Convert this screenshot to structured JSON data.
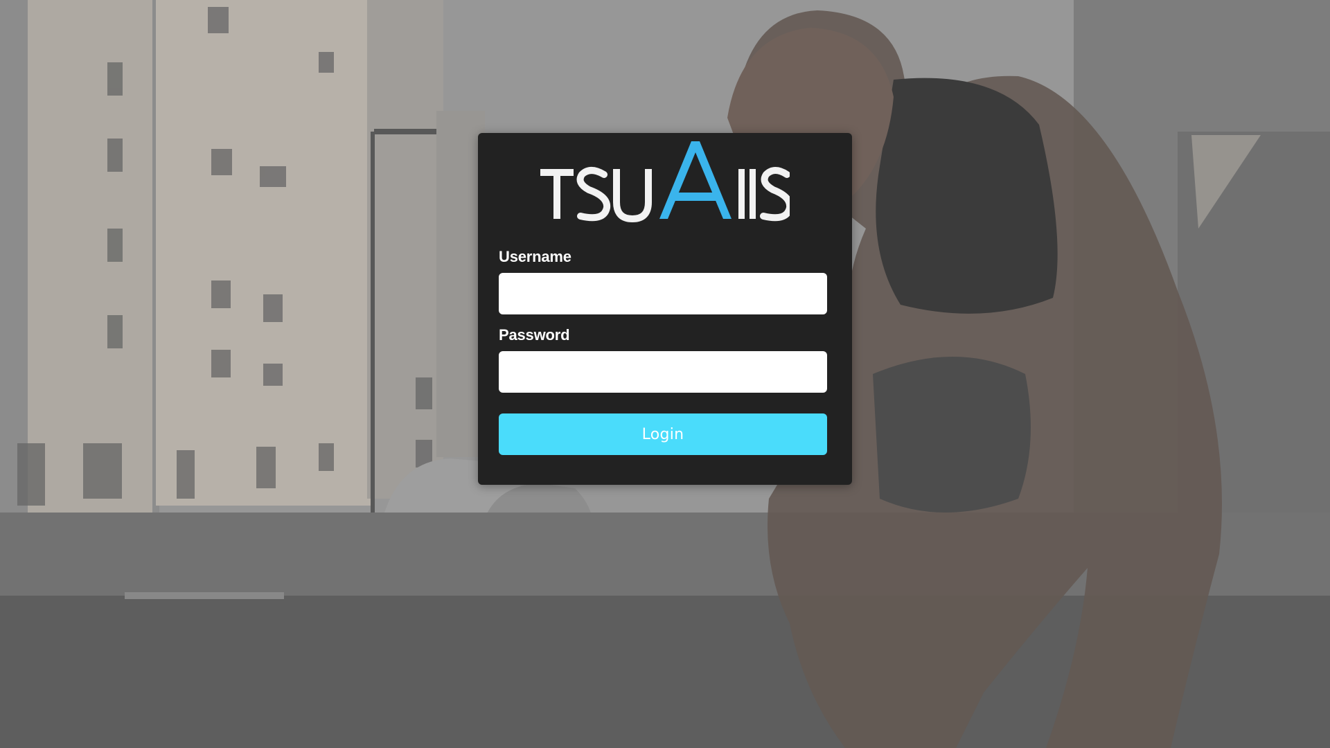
{
  "logo": {
    "text": "TSUAIIS",
    "accent_color": "#3ab4ec",
    "text_color": "#f2f2f2"
  },
  "form": {
    "username_label": "Username",
    "username_value": "",
    "password_label": "Password",
    "password_value": "",
    "login_label": "Login",
    "button_color": "#4adcfb"
  },
  "background": {
    "description_icon": "runner-city-background"
  }
}
